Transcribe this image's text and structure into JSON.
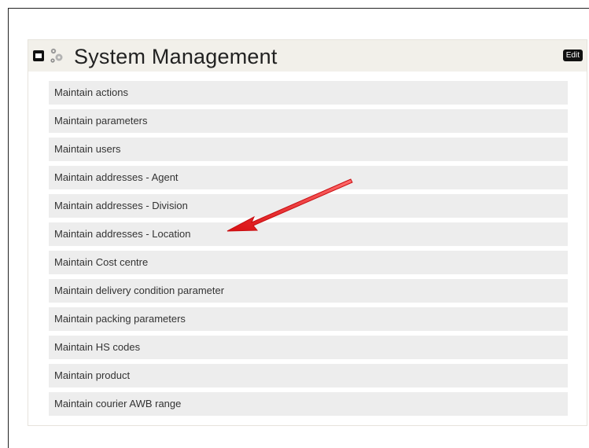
{
  "panel": {
    "title": "System Management",
    "edit_label": "Edit",
    "icons": [
      "collapse-icon",
      "gear-icon"
    ]
  },
  "menu": {
    "items": [
      {
        "label": "Maintain actions"
      },
      {
        "label": "Maintain parameters"
      },
      {
        "label": "Maintain users"
      },
      {
        "label": "Maintain addresses - Agent"
      },
      {
        "label": "Maintain addresses - Division"
      },
      {
        "label": "Maintain addresses - Location"
      },
      {
        "label": "Maintain Cost centre"
      },
      {
        "label": "Maintain delivery condition parameter"
      },
      {
        "label": "Maintain packing parameters"
      },
      {
        "label": "Maintain HS codes"
      },
      {
        "label": "Maintain product"
      },
      {
        "label": "Maintain courier AWB range"
      }
    ]
  },
  "annotation": {
    "type": "arrow",
    "color": "#e8191c",
    "points_to": "Maintain addresses - Location"
  }
}
